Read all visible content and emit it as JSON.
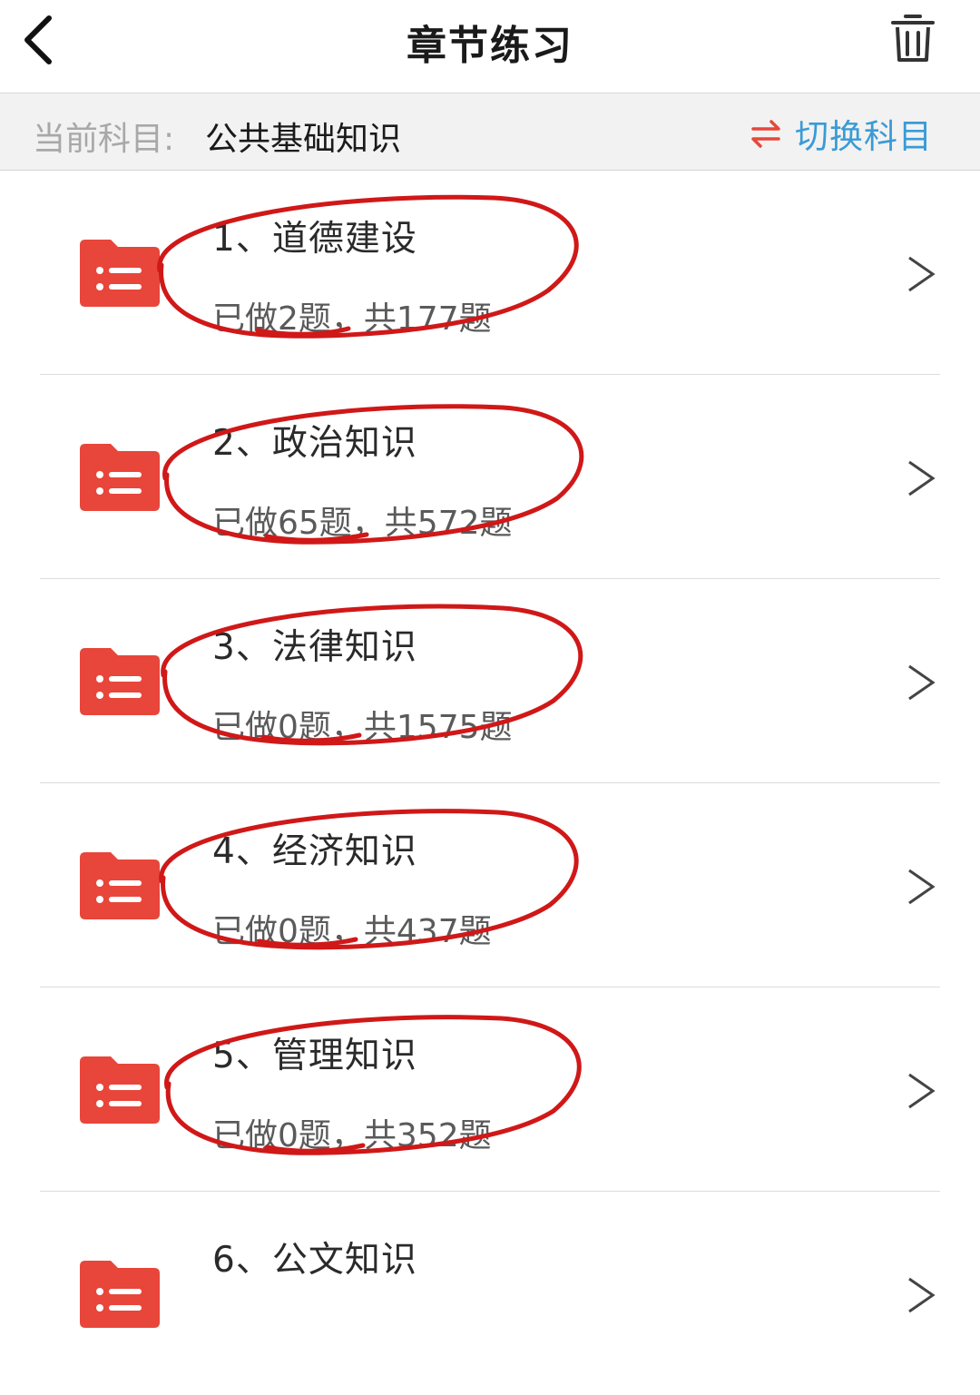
{
  "header": {
    "title": "章节练习",
    "back_icon": "chevron-left-icon",
    "trash_icon": "trash-icon"
  },
  "subject_bar": {
    "label": "当前科目:",
    "value": "公共基础知识",
    "switch_label": "切换科目",
    "switch_icon": "swap-arrows-icon",
    "switch_color": "#3a9bd6",
    "switch_icon_color": "#e8463a"
  },
  "colors": {
    "folder": "#e8463a",
    "annotation": "#d01818"
  },
  "chapters": [
    {
      "title": "1、道德建设",
      "progress": "已做2题，共177题"
    },
    {
      "title": "2、政治知识",
      "progress": "已做65题，共572题"
    },
    {
      "title": "3、法律知识",
      "progress": "已做0题，共1575题"
    },
    {
      "title": "4、经济知识",
      "progress": "已做0题，共437题"
    },
    {
      "title": "5、管理知识",
      "progress": "已做0题，共352题"
    },
    {
      "title": "6、公文知识",
      "progress": ""
    }
  ]
}
